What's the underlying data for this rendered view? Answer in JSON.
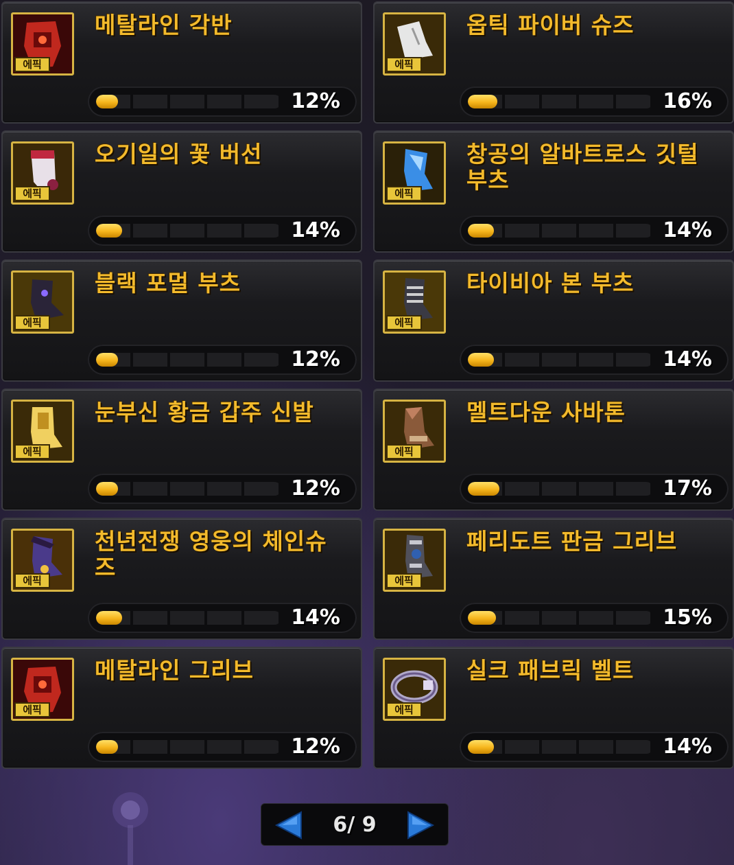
{
  "items": [
    {
      "name": "메탈라인 각반",
      "percent_label": "12%",
      "progress": 12,
      "badge": "에픽",
      "icon": "red-armor-legging-icon",
      "icon_color": "#c0281e"
    },
    {
      "name": "옵틱 파이버 슈즈",
      "percent_label": "16%",
      "progress": 16,
      "badge": "에픽",
      "icon": "white-shoe-icon",
      "icon_color": "#e6e6e6"
    },
    {
      "name": "오기일의 꽃 버선",
      "percent_label": "14%",
      "progress": 14,
      "badge": "에픽",
      "icon": "flower-sock-icon",
      "icon_color": "#e8e0e8"
    },
    {
      "name": "창공의 알바트로스 깃털 부츠",
      "percent_label": "14%",
      "progress": 14,
      "badge": "에픽",
      "icon": "blue-feather-boot-icon",
      "icon_color": "#3a8ee6"
    },
    {
      "name": "블랙 포멀 부츠",
      "percent_label": "12%",
      "progress": 12,
      "badge": "에픽",
      "icon": "black-boot-icon",
      "icon_color": "#2a2438"
    },
    {
      "name": "타이비아 본 부츠",
      "percent_label": "14%",
      "progress": 14,
      "badge": "에픽",
      "icon": "bone-boot-icon",
      "icon_color": "#3a3a44"
    },
    {
      "name": "눈부신 황금 갑주 신발",
      "percent_label": "12%",
      "progress": 12,
      "badge": "에픽",
      "icon": "golden-armor-shoe-icon",
      "icon_color": "#f0d060"
    },
    {
      "name": "멜트다운 사바톤",
      "percent_label": "17%",
      "progress": 17,
      "badge": "에픽",
      "icon": "sabaton-icon",
      "icon_color": "#8a5a3a"
    },
    {
      "name": "천년전쟁 영웅의 체인슈즈",
      "percent_label": "14%",
      "progress": 14,
      "badge": "에픽",
      "icon": "chain-shoe-icon",
      "icon_color": "#4a3a8a"
    },
    {
      "name": "페리도트 판금 그리브",
      "percent_label": "15%",
      "progress": 15,
      "badge": "에픽",
      "icon": "plate-greave-icon",
      "icon_color": "#3060b0"
    },
    {
      "name": "메탈라인 그리브",
      "percent_label": "12%",
      "progress": 12,
      "badge": "에픽",
      "icon": "red-greave-icon",
      "icon_color": "#c0281e"
    },
    {
      "name": "실크 패브릭 벨트",
      "percent_label": "14%",
      "progress": 14,
      "badge": "에픽",
      "icon": "silk-belt-icon",
      "icon_color": "#b0a8c8"
    }
  ],
  "pagination": {
    "text": "6/ 9",
    "prev_icon": "arrow-left-icon",
    "next_icon": "arrow-right-icon"
  },
  "colors": {
    "name_text": "#f3ba2c",
    "bar_fill": "#f6b51c",
    "frame": "#d7b443",
    "arrow": "#2a7ad8"
  }
}
